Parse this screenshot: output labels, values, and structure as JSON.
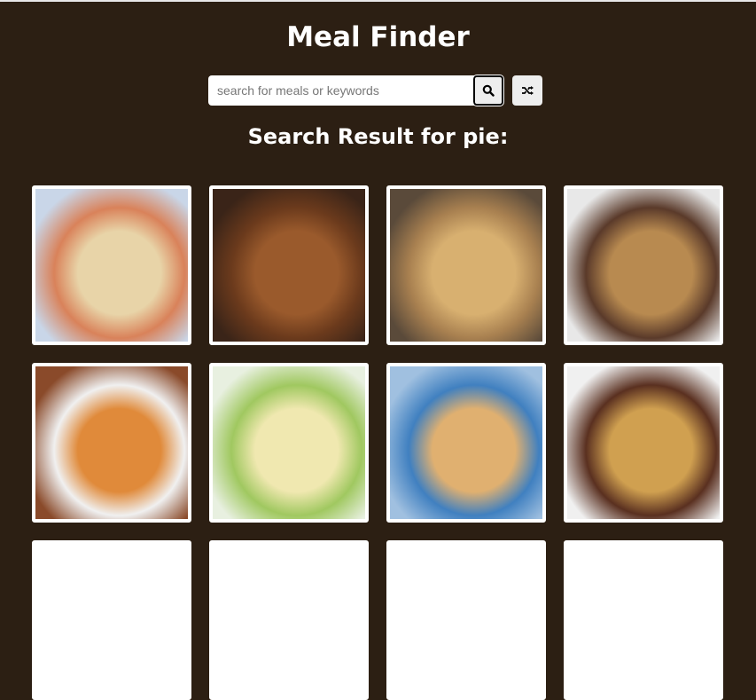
{
  "header": {
    "title": "Meal Finder"
  },
  "search": {
    "placeholder": "search for meals or keywords",
    "value": "",
    "search_icon": "search-icon",
    "random_icon": "shuffle-icon"
  },
  "results": {
    "heading": "Search Result for pie:"
  },
  "meals": [
    {
      "colors": [
        "#c9d6e8",
        "#e8d4a8",
        "#d9825a"
      ]
    },
    {
      "colors": [
        "#3a2418",
        "#9a5a2c",
        "#6b3a1c"
      ]
    },
    {
      "colors": [
        "#5a4a3a",
        "#d8b070",
        "#a88050"
      ]
    },
    {
      "colors": [
        "#e8e8e8",
        "#b88a50",
        "#5a3a2a"
      ]
    },
    {
      "colors": [
        "#8a4a2a",
        "#e08a3a",
        "#f0f0f0"
      ]
    },
    {
      "colors": [
        "#e8f0e0",
        "#f0e8b0",
        "#a0c860"
      ]
    },
    {
      "colors": [
        "#a0c0e0",
        "#e0b070",
        "#4080c0"
      ]
    },
    {
      "colors": [
        "#f0f0f0",
        "#d0a050",
        "#5a3020"
      ]
    },
    {
      "colors": [
        "#fff",
        "#fff",
        "#fff"
      ]
    },
    {
      "colors": [
        "#fff",
        "#fff",
        "#fff"
      ]
    },
    {
      "colors": [
        "#fff",
        "#fff",
        "#fff"
      ]
    },
    {
      "colors": [
        "#fff",
        "#fff",
        "#fff"
      ]
    }
  ]
}
